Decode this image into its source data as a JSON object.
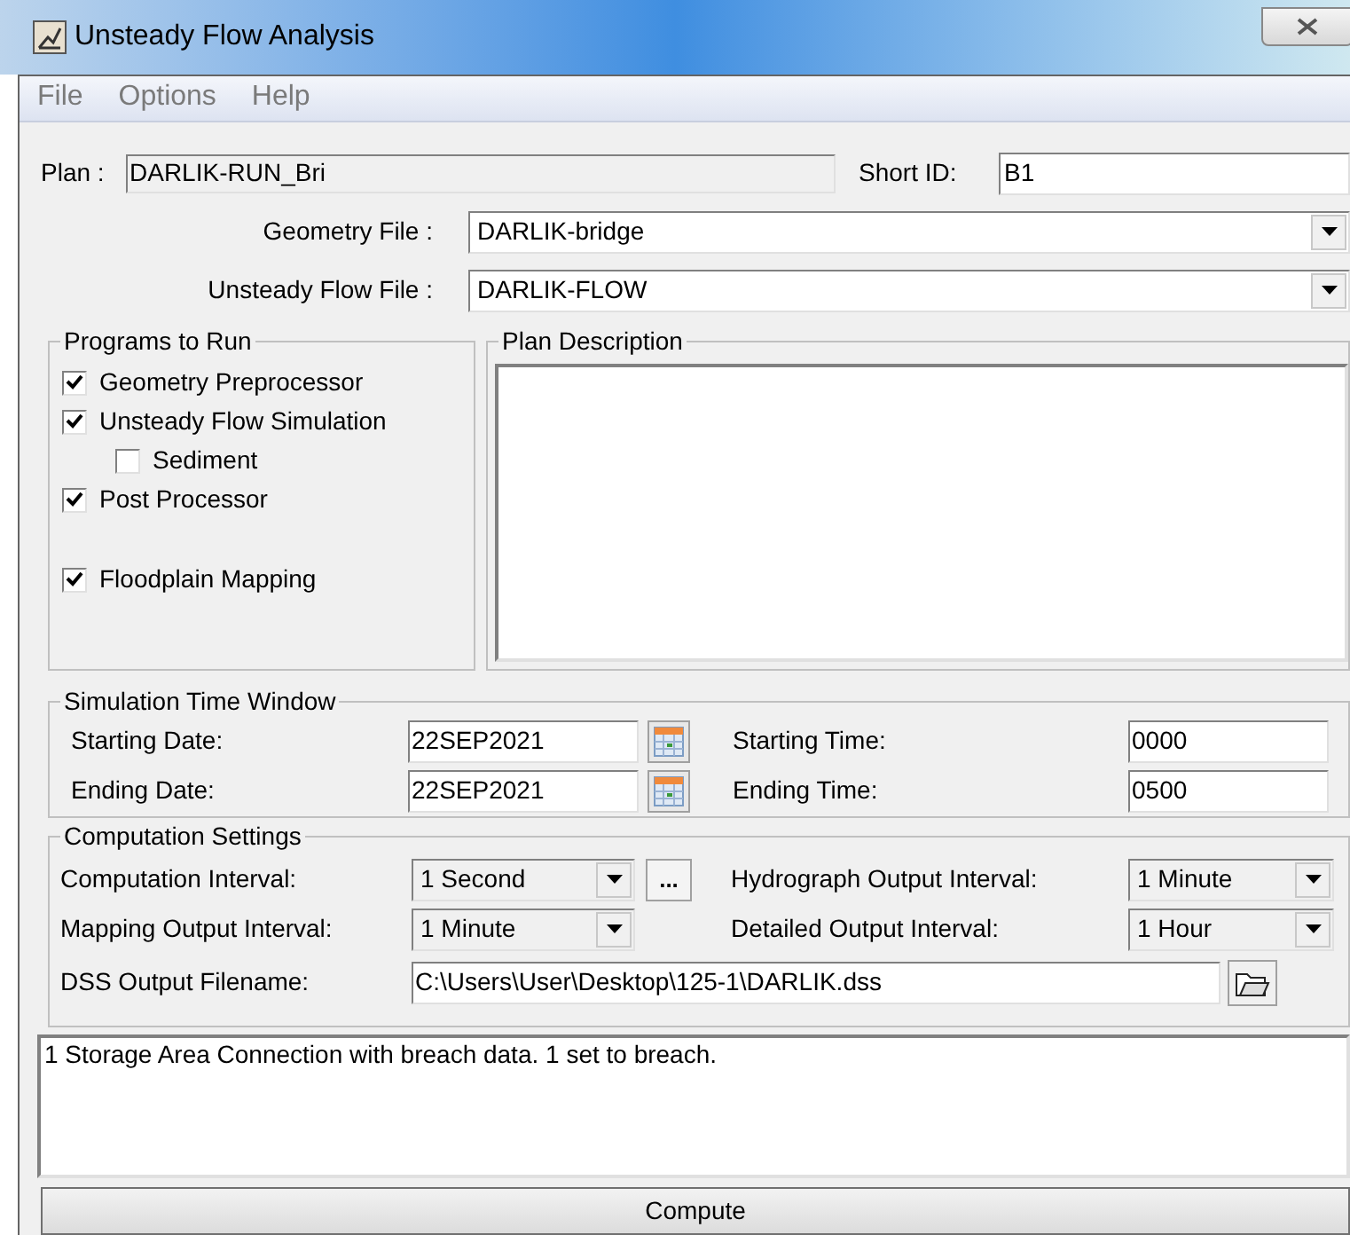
{
  "window": {
    "title": "Unsteady Flow Analysis"
  },
  "menu": [
    "File",
    "Options",
    "Help"
  ],
  "plan": {
    "label": "Plan :",
    "value": "DARLIK-RUN_Bri"
  },
  "short_id": {
    "label": "Short ID:",
    "value": "B1"
  },
  "files": [
    {
      "label": "Geometry File :",
      "value": "DARLIK-bridge"
    },
    {
      "label": "Unsteady Flow File :",
      "value": "DARLIK-FLOW"
    }
  ],
  "programs": {
    "title": "Programs to Run",
    "items": [
      {
        "label": "Geometry Preprocessor",
        "checked": true
      },
      {
        "label": "Unsteady Flow Simulation",
        "checked": true,
        "children": [
          {
            "label": "Sediment",
            "checked": false
          }
        ]
      },
      {
        "label": "Post Processor",
        "checked": true
      },
      {
        "label": "Floodplain Mapping",
        "checked": true
      }
    ]
  },
  "plan_description": {
    "title": "Plan Description"
  },
  "time_window": {
    "title": "Simulation Time Window",
    "rows": [
      {
        "date_label": "Starting Date:",
        "date": "22SEP2021",
        "time_label": "Starting Time:",
        "time": "0000"
      },
      {
        "date_label": "Ending Date:",
        "date": "22SEP2021",
        "time_label": "Ending Time:",
        "time": "0500"
      }
    ]
  },
  "computation": {
    "title": "Computation Settings",
    "rows": [
      [
        {
          "label": "Computation Interval:",
          "value": "1 Second",
          "button": "..."
        },
        {
          "label": "Hydrograph Output Interval:",
          "value": "1 Minute"
        }
      ],
      [
        {
          "label": "Mapping Output Interval:",
          "value": "1 Minute"
        },
        {
          "label": "Detailed Output Interval:",
          "value": "1 Hour"
        }
      ]
    ],
    "dss": {
      "label": "DSS Output Filename:",
      "value": "C:\\Users\\User\\Desktop\\125-1\\DARLIK.dss"
    }
  },
  "messages": [
    "1 Storage Area Connection with breach data. 1 set to breach."
  ],
  "compute_button": "Compute"
}
